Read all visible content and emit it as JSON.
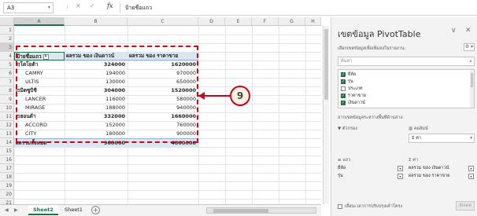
{
  "formula_bar": {
    "name_box": "A3",
    "cancel_icon": "✕",
    "enter_icon": "✓",
    "fx_label": "fx",
    "content": "ป้ายชื่อแถว"
  },
  "columns": [
    "A",
    "B",
    "C",
    "D",
    "E",
    "F",
    "G",
    "H"
  ],
  "rows": [
    "1",
    "2",
    "3",
    "4",
    "5",
    "6",
    "7",
    "8",
    "9",
    "10",
    "11",
    "12",
    "13",
    "14",
    "15",
    "16",
    "17",
    "18",
    "19",
    "20",
    "21"
  ],
  "pivot": {
    "header": {
      "label": "ป้ายชื่อแถว",
      "col1": "ผลรวม ของ เงินดาวน์",
      "col2": "ผลรวม ของ ราคาขาย"
    },
    "lines": [
      {
        "label": "⊟โตโยต้า",
        "v1": "324000",
        "v2": "1620000",
        "kind": "sub"
      },
      {
        "label": "CAMRY",
        "v1": "194000",
        "v2": "970000",
        "kind": "item"
      },
      {
        "label": "ULTIS",
        "v1": "130000",
        "v2": "650000",
        "kind": "item"
      },
      {
        "label": "⊟มิตซูบิชิ",
        "v1": "304000",
        "v2": "1520000",
        "kind": "sub"
      },
      {
        "label": "LANCER",
        "v1": "116000",
        "v2": "580000",
        "kind": "item"
      },
      {
        "label": "MIRAGE",
        "v1": "188000",
        "v2": "940000",
        "kind": "item"
      },
      {
        "label": "⊟ฮอนด้า",
        "v1": "332000",
        "v2": "1660000",
        "kind": "sub"
      },
      {
        "label": "ACCORD",
        "v1": "152000",
        "v2": "760000",
        "kind": "item"
      },
      {
        "label": "CITY",
        "v1": "180000",
        "v2": "900000",
        "kind": "item"
      }
    ],
    "total": {
      "label": "ผลรวมทั้งหมด",
      "v1": "960000",
      "v2": "4800000"
    }
  },
  "callout": {
    "number": "9",
    "color": "#d0021b"
  },
  "sheet_tabs": {
    "nav_prev": "◀",
    "nav_next": "▶",
    "tabs": [
      "Sheet2",
      "Sheet1"
    ],
    "active": "Sheet2",
    "add": "+"
  },
  "pane": {
    "title": "เขตข้อมูล PivotTable",
    "collapse_icon": "∨",
    "close_icon": "✕",
    "subtitle": "เลือกเขตข้อมูลเพื่อเพิ่มลงในรายงาน:",
    "gear": "⚙ ▾",
    "search_placeholder": "ค้นหา",
    "search_icon": "⌕",
    "fields": [
      {
        "name": "ยี่ห้อ",
        "checked": true
      },
      {
        "name": "รุ่น",
        "checked": true
      },
      {
        "name": "ประเภท",
        "checked": false
      },
      {
        "name": "ราคาขาย",
        "checked": true
      },
      {
        "name": "เงินดาวน์",
        "checked": true
      }
    ],
    "drag_label": "ลากเขตข้อมูลระหว่างพื้นที่ด้านล่าง:",
    "filters_label": "ตัวกรอง",
    "columns_label": "คอลัมน์",
    "columns_value": "Σ ค่า",
    "rows_label": "แถว",
    "values_label": "Σ ค่า",
    "row_items": [
      "ยี่ห้อ",
      "รุ่น"
    ],
    "value_items": [
      "ผลรวม ของ เงินดาวน์",
      "ผลรวม ของ ราคาขาย"
    ],
    "defer_label": "เลื่อนเวลาการปรับปรุงเค้าโครง",
    "update_label": "อัปเดต",
    "accent": "#217346"
  }
}
